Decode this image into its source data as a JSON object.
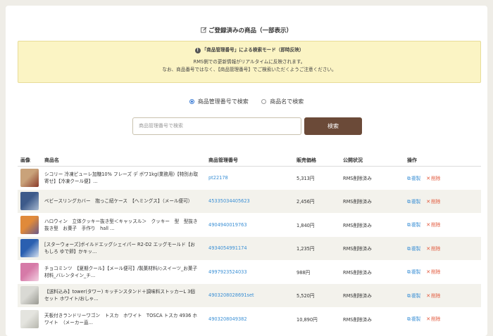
{
  "page": {
    "title": "ご登録済みの商品（一部表示）"
  },
  "notice": {
    "heading": "「商品管理番号」による検索モード（即時反映）",
    "line1": "RMS側での更新情報がリアルタイムに反映されます。",
    "line2": "なお、商品番号ではなく、【商品管理番号】でご検索いただくようご注意ください。"
  },
  "search": {
    "options": [
      "商品管理番号で検索",
      "商品名で検索"
    ],
    "selected": "商品管理番号で検索",
    "placeholder": "商品管理番号で検索",
    "button_label": "検索"
  },
  "table": {
    "headers": [
      "画像",
      "商品名",
      "商品管理番号",
      "販売価格",
      "公開状況",
      "操作"
    ],
    "copy_label": "複製",
    "delete_label": "削除",
    "rows": [
      {
        "name": "シコリー 冷凍ピューレ加糖10% フレーズ デ ボワ1kg(業務用)【特別お取寄せ】【冷凍クール便】...",
        "code": "pt22178",
        "price": "5,313円",
        "status": "RMS削除済み",
        "thumb": [
          "#c9a27a",
          "#8a3a2a"
        ]
      },
      {
        "name": "ベビースリングカバー　抱っこ紐ケース　【ヘミングス】（メール便可）",
        "code": "45335034405623",
        "price": "2,456円",
        "status": "RMS削除済み",
        "thumb": [
          "#3d5a8a",
          "#a7b8cf"
        ]
      },
      {
        "name": "ハロウィン　立体クッキー抜き型＜キャッスル＞　クッキー　型　型抜き　抜き型　お菓子　手作り　hall ...",
        "code": "4904940019763",
        "price": "1,840円",
        "status": "RMS削除済み",
        "thumb": [
          "#e08a3a",
          "#6a5a8a"
        ]
      },
      {
        "name": "[スターウォーズ]ボイルドエッグシェイパー R2-D2 エッグモールド【おもしろ ゆで卵】かキッ...",
        "code": "4934054991174",
        "price": "1,235円",
        "status": "RMS削除済み",
        "thumb": [
          "#2a5fb0",
          "#d8e2f0"
        ]
      },
      {
        "name": "チョコミンツ　【夏期クール】【メール便可】/製菓材料/◇スイーツ_お菓子材料_バレンタイン_チ...",
        "code": "4997923524033",
        "price": "988円",
        "status": "RMS削除済み",
        "thumb": [
          "#d67aa8",
          "#f3d1e2"
        ]
      },
      {
        "name": "【送料込み】tower(タワー) キッチンスタンド＋調味料ストッカーL 3個セット ホワイト/おしゃ...",
        "code": "4903208028691set",
        "price": "5,520円",
        "status": "RMS削除済み",
        "thumb": [
          "#d9d9d4",
          "#9a9a92"
        ]
      },
      {
        "name": "天板付きランドリーワゴン　トスカ　ホワイト　TOSCA トスカ 4936 ホワイト　（メーカー直...",
        "code": "4903208049382",
        "price": "10,890円",
        "status": "RMS削除済み",
        "thumb": [
          "#e4e4df",
          "#b7b7ae"
        ]
      }
    ]
  }
}
